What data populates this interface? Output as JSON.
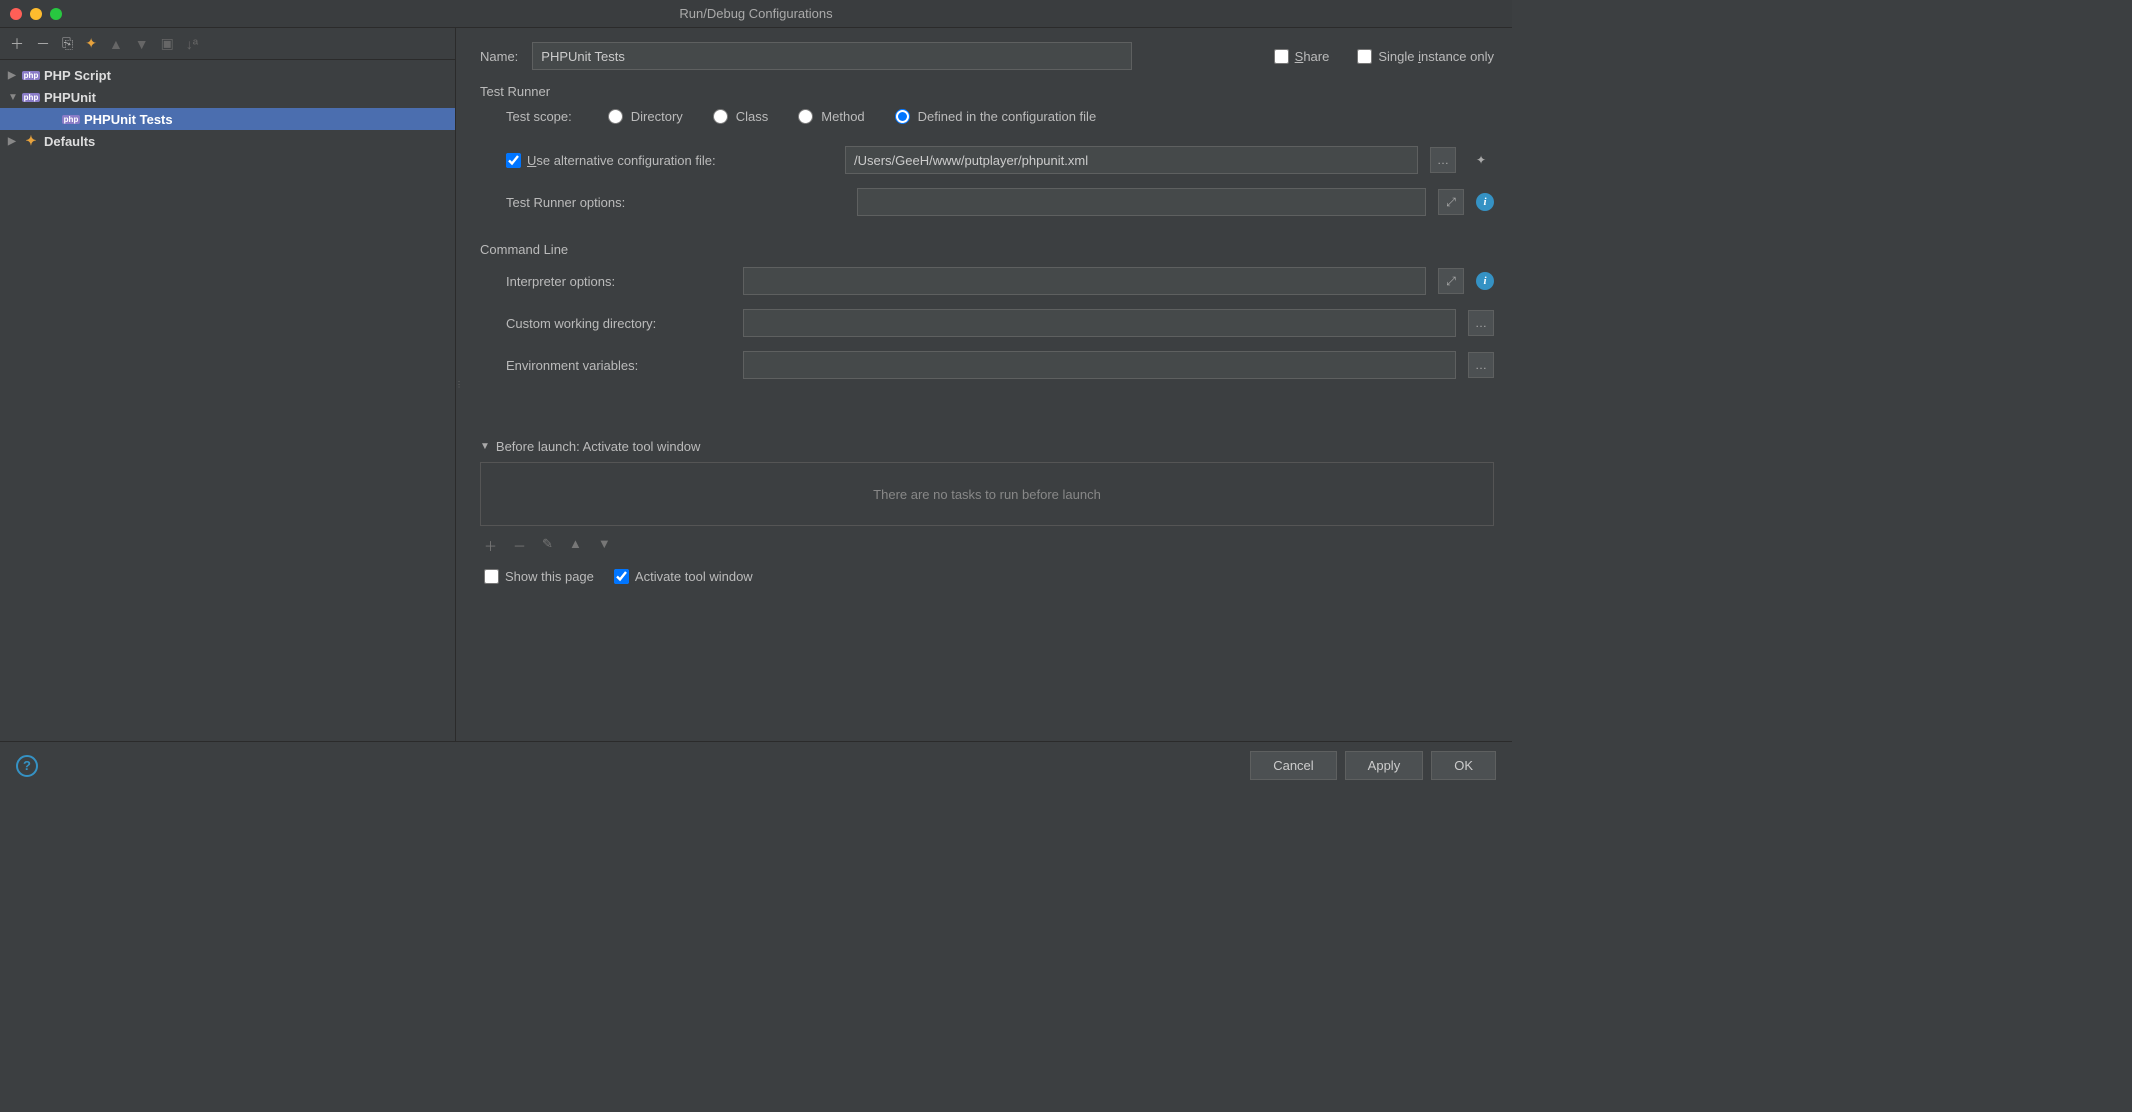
{
  "window": {
    "title": "Run/Debug Configurations"
  },
  "tree": {
    "items": [
      {
        "label": "PHP Script"
      },
      {
        "label": "PHPUnit"
      },
      {
        "label": "PHPUnit Tests"
      },
      {
        "label": "Defaults"
      }
    ]
  },
  "form": {
    "name_label": "Name:",
    "name_value": "PHPUnit Tests",
    "share_label": "Share",
    "single_instance_label": "Single instance only",
    "test_runner": {
      "title": "Test Runner",
      "scope_label": "Test scope:",
      "scope_options": {
        "directory": "Directory",
        "class": "Class",
        "method": "Method",
        "config": "Defined in the configuration file"
      },
      "alt_config_label": "Use alternative configuration file:",
      "alt_config_value": "/Users/GeeH/www/putplayer/phpunit.xml",
      "runner_options_label": "Test Runner options:",
      "runner_options_value": ""
    },
    "command_line": {
      "title": "Command Line",
      "interpreter_label": "Interpreter options:",
      "interpreter_value": "",
      "cwd_label": "Custom working directory:",
      "cwd_value": "",
      "env_label": "Environment variables:",
      "env_value": ""
    },
    "before_launch": {
      "title": "Before launch: Activate tool window",
      "empty": "There are no tasks to run before launch",
      "show_page": "Show this page",
      "activate_window": "Activate tool window"
    }
  },
  "footer": {
    "cancel": "Cancel",
    "apply": "Apply",
    "ok": "OK"
  }
}
